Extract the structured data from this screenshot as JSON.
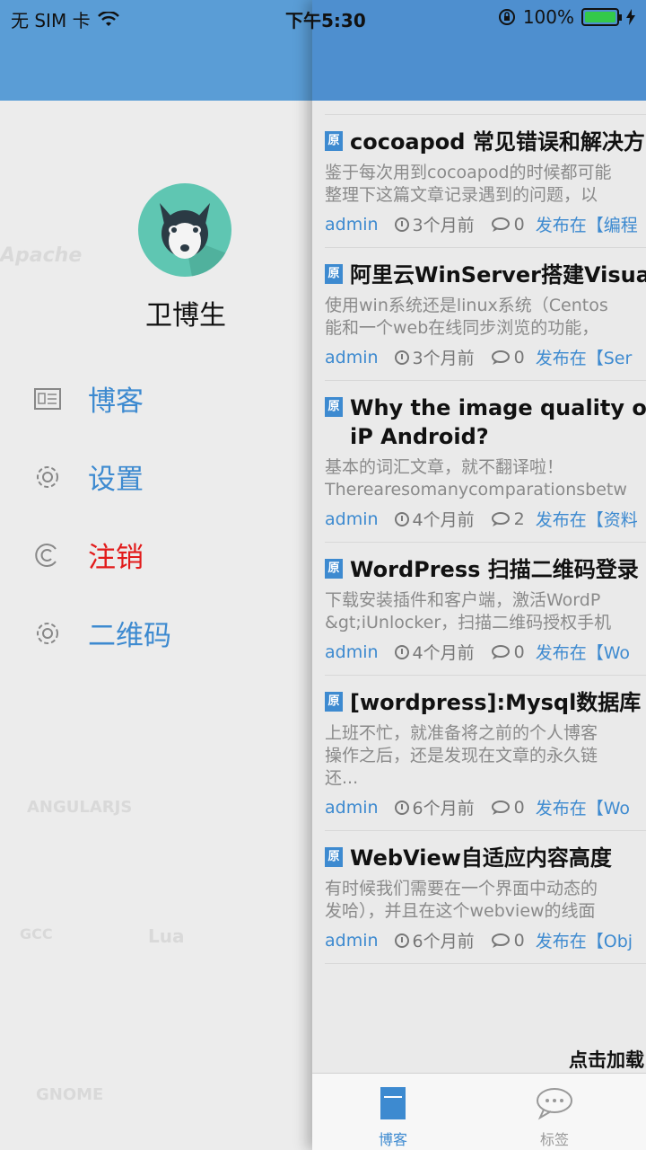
{
  "status_bar": {
    "carrier": "无 SIM 卡",
    "time": "下午5:30",
    "battery": "100%"
  },
  "drawer": {
    "username": "卫博生",
    "background_marks": [
      "Apache",
      "ANGULARJS",
      "GNOME",
      "GCC",
      "Lua"
    ],
    "menu": [
      {
        "label": "博客",
        "icon": "news-icon"
      },
      {
        "label": "设置",
        "icon": "gear-icon"
      },
      {
        "label": "注销",
        "icon": "logout-icon"
      },
      {
        "label": "二维码",
        "icon": "gear-icon"
      }
    ]
  },
  "posts": [
    {
      "badge": "原",
      "title": "cocoapod 常见错误和解决方",
      "excerpt": "鉴于每次用到cocoapod的时候都可能\n整理下这篇文章记录遇到的问题，以",
      "author": "admin",
      "time": "3个月前",
      "comments": "0",
      "category": "发布在【编程"
    },
    {
      "badge": "原",
      "title": "阿里云WinServer搭建Visual",
      "excerpt": "使用win系统还是linux系统（Centos\n能和一个web在线同步浏览的功能，",
      "author": "admin",
      "time": "3个月前",
      "comments": "0",
      "category": "发布在【Ser"
    },
    {
      "badge": "原",
      "title": "Why the image quality of iP Android?",
      "excerpt": "基本的词汇文章，就不翻译啦！\nTherearesomanycomparationsbetw",
      "author": "admin",
      "time": "4个月前",
      "comments": "2",
      "category": "发布在【资料"
    },
    {
      "badge": "原",
      "title": "WordPress 扫描二维码登录",
      "excerpt": "下载安装插件和客户端，激活WordP\n&gt;iUnlocker，扫描二维码授权手机",
      "author": "admin",
      "time": "4个月前",
      "comments": "0",
      "category": "发布在【Wo"
    },
    {
      "badge": "原",
      "title": "[wordpress]:Mysql数据库 批",
      "excerpt": "上班不忙，就准备将之前的个人博客\n操作之后，还是发现在文章的永久链\n还...",
      "author": "admin",
      "time": "6个月前",
      "comments": "0",
      "category": "发布在【Wo"
    },
    {
      "badge": "原",
      "title": "WebView自适应内容高度",
      "excerpt": "有时候我们需要在一个界面中动态的\n发哈），并且在这个webview的线面",
      "author": "admin",
      "time": "6个月前",
      "comments": "0",
      "category": "发布在【Obj"
    }
  ],
  "load_more": "点击加载",
  "tabbar": {
    "tabs": [
      {
        "label": "博客",
        "icon": "blog-icon",
        "active": true
      },
      {
        "label": "标签",
        "icon": "chat-bubble-icon",
        "active": false
      }
    ]
  },
  "colors": {
    "header_blue": "#4e8fcf",
    "link_blue": "#3d8ad0",
    "logout_red": "#e21b1b"
  }
}
